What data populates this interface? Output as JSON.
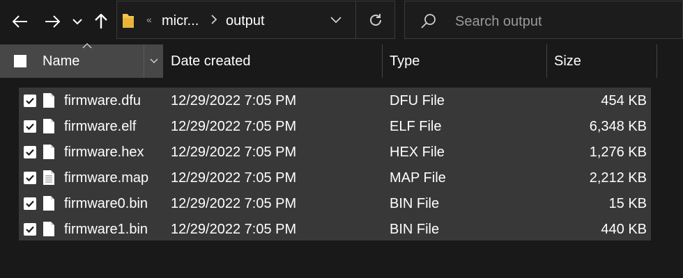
{
  "address": {
    "collapse_glyph": "«",
    "crumbs": [
      "micr...",
      "output"
    ]
  },
  "search": {
    "placeholder": "Search output"
  },
  "columns": {
    "name": "Name",
    "date": "Date created",
    "type": "Type",
    "size": "Size"
  },
  "files": [
    {
      "name": "firmware.dfu",
      "date": "12/29/2022 7:05 PM",
      "type": "DFU File",
      "size": "454 KB",
      "icon": "blank-file-icon"
    },
    {
      "name": "firmware.elf",
      "date": "12/29/2022 7:05 PM",
      "type": "ELF File",
      "size": "6,348 KB",
      "icon": "blank-file-icon"
    },
    {
      "name": "firmware.hex",
      "date": "12/29/2022 7:05 PM",
      "type": "HEX File",
      "size": "1,276 KB",
      "icon": "blank-file-icon"
    },
    {
      "name": "firmware.map",
      "date": "12/29/2022 7:05 PM",
      "type": "MAP File",
      "size": "2,212 KB",
      "icon": "text-file-icon"
    },
    {
      "name": "firmware0.bin",
      "date": "12/29/2022 7:05 PM",
      "type": "BIN File",
      "size": "15 KB",
      "icon": "blank-file-icon"
    },
    {
      "name": "firmware1.bin",
      "date": "12/29/2022 7:05 PM",
      "type": "BIN File",
      "size": "440 KB",
      "icon": "blank-file-icon"
    }
  ],
  "colors": {
    "background": "#191919",
    "selected": "#383838",
    "header_active": "#474747",
    "folder": "#f3c44b"
  }
}
